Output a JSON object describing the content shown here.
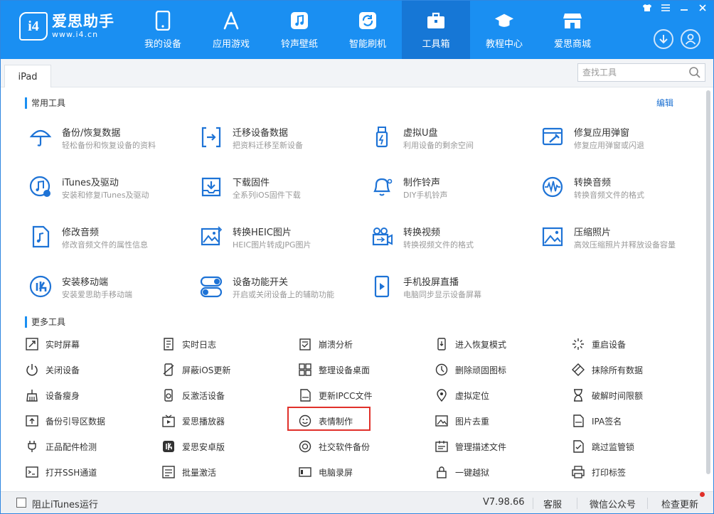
{
  "app": {
    "logo_badge": "i4",
    "name": "爱思助手",
    "url": "www.i4.cn"
  },
  "nav": [
    {
      "label": "我的设备",
      "icon": "phone-icon"
    },
    {
      "label": "应用游戏",
      "icon": "app-store-icon"
    },
    {
      "label": "铃声壁纸",
      "icon": "music-icon"
    },
    {
      "label": "智能刷机",
      "icon": "flash-icon"
    },
    {
      "label": "工具箱",
      "icon": "toolbox-icon",
      "active": true
    },
    {
      "label": "教程中心",
      "icon": "graduation-cap-icon"
    },
    {
      "label": "爱思商城",
      "icon": "store-icon"
    }
  ],
  "window_controls": [
    "shirt-icon",
    "menu-icon",
    "minimize-icon",
    "close-icon"
  ],
  "tabs": [
    {
      "label": "iPad"
    }
  ],
  "search": {
    "placeholder": "查找工具"
  },
  "sections": {
    "common": "常用工具",
    "edit": "编辑",
    "more": "更多工具"
  },
  "common_tools": [
    {
      "name": "备份/恢复数据",
      "desc": "轻松备份和恢复设备的资料",
      "icon": "umbrella-icon"
    },
    {
      "name": "迁移设备数据",
      "desc": "把资料迁移至新设备",
      "icon": "transfer-icon"
    },
    {
      "name": "虚拟U盘",
      "desc": "利用设备的剩余空间",
      "icon": "usb-drive-icon"
    },
    {
      "name": "修复应用弹窗",
      "desc": "修复应用弹窗或闪退",
      "icon": "repair-window-icon"
    },
    {
      "name": "iTunes及驱动",
      "desc": "安装和修复iTunes及驱动",
      "icon": "itunes-icon"
    },
    {
      "name": "下载固件",
      "desc": "全系列iOS固件下载",
      "icon": "download-tray-icon"
    },
    {
      "name": "制作铃声",
      "desc": "DIY手机铃声",
      "icon": "bell-icon"
    },
    {
      "name": "转换音频",
      "desc": "转换音频文件的格式",
      "icon": "audio-wave-icon"
    },
    {
      "name": "修改音频",
      "desc": "修改音频文件的属性信息",
      "icon": "music-file-icon"
    },
    {
      "name": "转换HEIC图片",
      "desc": "HEIC图片转成JPG图片",
      "icon": "image-convert-icon"
    },
    {
      "name": "转换视频",
      "desc": "转换视频文件的格式",
      "icon": "video-convert-icon"
    },
    {
      "name": "压缩照片",
      "desc": "高效压缩照片并释放设备容量",
      "icon": "photo-compress-icon"
    },
    {
      "name": "安装移动端",
      "desc": "安装爱思助手移动端",
      "icon": "i4-mobile-icon"
    },
    {
      "name": "设备功能开关",
      "desc": "开启或关闭设备上的辅助功能",
      "icon": "toggle-icon"
    },
    {
      "name": "手机投屏直播",
      "desc": "电脑同步显示设备屏幕",
      "icon": "screen-mirror-icon"
    }
  ],
  "more_tools": [
    {
      "name": "实时屏幕",
      "icon": "realtime-screen-icon"
    },
    {
      "name": "实时日志",
      "icon": "log-icon"
    },
    {
      "name": "崩溃分析",
      "icon": "crash-report-icon"
    },
    {
      "name": "进入恢复模式",
      "icon": "recovery-mode-icon"
    },
    {
      "name": "重启设备",
      "icon": "restart-icon"
    },
    {
      "name": "关闭设备",
      "icon": "power-icon"
    },
    {
      "name": "屏蔽iOS更新",
      "icon": "block-update-icon"
    },
    {
      "name": "整理设备桌面",
      "icon": "grid-icon"
    },
    {
      "name": "删除顽固图标",
      "icon": "delete-icon-icon"
    },
    {
      "name": "抹除所有数据",
      "icon": "eraser-icon"
    },
    {
      "name": "设备瘦身",
      "icon": "broom-icon"
    },
    {
      "name": "反激活设备",
      "icon": "deactivate-icon"
    },
    {
      "name": "更新IPCC文件",
      "icon": "ipcc-file-icon"
    },
    {
      "name": "虚拟定位",
      "icon": "location-pin-icon"
    },
    {
      "name": "破解时间限额",
      "icon": "hourglass-icon"
    },
    {
      "name": "备份引导区数据",
      "icon": "boot-backup-icon"
    },
    {
      "name": "爱思播放器",
      "icon": "tv-player-icon"
    },
    {
      "name": "表情制作",
      "icon": "smiley-icon"
    },
    {
      "name": "图片去重",
      "icon": "image-dedupe-icon"
    },
    {
      "name": "IPA签名",
      "icon": "ipa-file-icon"
    },
    {
      "name": "正品配件检测",
      "icon": "plug-icon"
    },
    {
      "name": "爱思安卓版",
      "icon": "i4-android-icon"
    },
    {
      "name": "社交软件备份",
      "icon": "social-backup-icon"
    },
    {
      "name": "管理描述文件",
      "icon": "profile-icon"
    },
    {
      "name": "跳过监管锁",
      "icon": "skip-lock-icon"
    },
    {
      "name": "打开SSH通道",
      "icon": "terminal-icon"
    },
    {
      "name": "批量激活",
      "icon": "batch-activate-icon"
    },
    {
      "name": "电脑录屏",
      "icon": "screen-record-icon"
    },
    {
      "name": "一键越狱",
      "icon": "padlock-icon"
    },
    {
      "name": "打印标签",
      "icon": "printer-icon"
    }
  ],
  "footer": {
    "block_itunes": "阻止iTunes运行",
    "version": "V7.98.66",
    "service": "客服",
    "wechat": "微信公众号",
    "update": "检查更新"
  },
  "colors": {
    "brand": "#1a8ff2",
    "nav_active": "#1677d6",
    "icon_blue": "#1e73d6",
    "highlight_red": "#e0302a"
  }
}
